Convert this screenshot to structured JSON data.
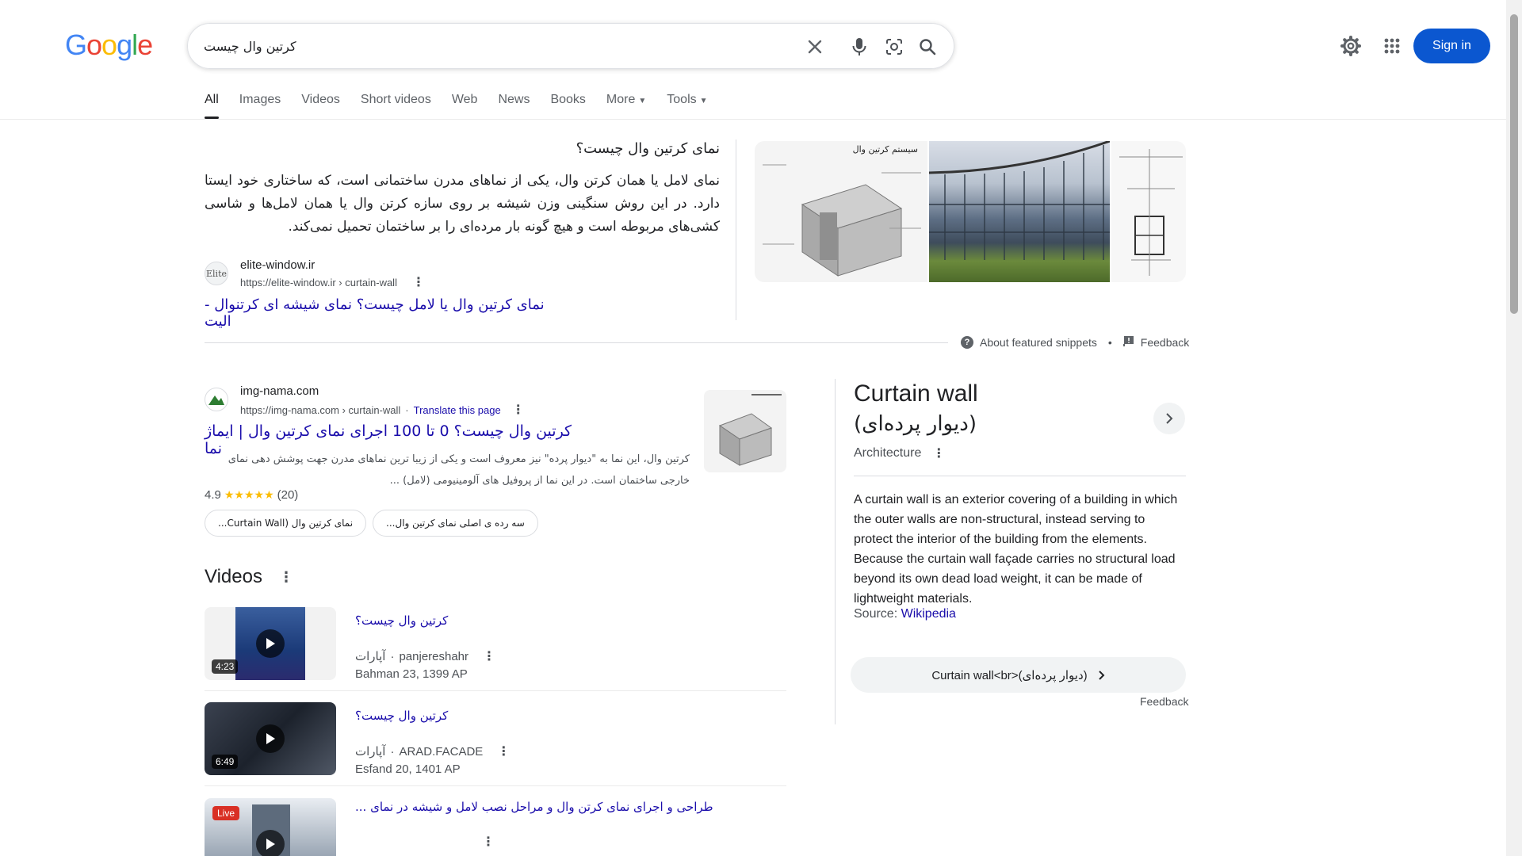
{
  "header": {
    "logo": [
      "G",
      "o",
      "o",
      "g",
      "l",
      "e"
    ],
    "search_value": "کرتین وال چیست",
    "sign_in": "Sign in"
  },
  "tabs": [
    {
      "label": "All",
      "active": true
    },
    {
      "label": "Images"
    },
    {
      "label": "Videos"
    },
    {
      "label": "Short videos"
    },
    {
      "label": "Web"
    },
    {
      "label": "News"
    },
    {
      "label": "Books"
    },
    {
      "label": "More"
    },
    {
      "label": "Tools"
    }
  ],
  "featured_snippet": {
    "question": "نمای کرتین وال چیست؟",
    "text": "نمای لامل یا همان کرتن وال، یکی از نماهای مدرن ساختمانی است، که ساختاری خود ایستا دارد. در این روش سنگینی وزن شیشه بر روی سازه کرتن وال یا همان لامل‌ها و شاسی کشی‌های مربوطه است و هیچ گونه بار مرده‌ای را بر ساختمان تحمیل نمی‌کند.",
    "site_name": "elite-window.ir",
    "site_url": "https://elite-window.ir › curtain-wall",
    "favicon_text": "Elite",
    "link_title": "نمای کرتین وال یا لامل چیست؟ نمای شیشه ای کرتنوال - الیت",
    "image1_label": "سیستم کرتین وال",
    "about": "About featured snippets",
    "feedback": "Feedback"
  },
  "result2": {
    "site_name": "img-nama.com",
    "site_url": "https://img-nama.com › curtain-wall",
    "translate": "Translate this page",
    "title": "کرتین وال چیست؟ 0 تا 100 اجرای نمای کرتین وال | ایماژ نما",
    "snippet": "کرتین وال، این نما به \"دیوار پرده\" نیز معروف است و یکی از زیبا ترین نماهای مدرن جهت پوشش دهی نمای خارجی ساختمان است. در این نما از پروفیل های آلومینیومی (لامل) ...",
    "rating": "4.9",
    "stars": "★★★★★",
    "count": "(20)",
    "chips": [
      "نمای کرتین وال (Curtain Wall...",
      "سه رده ی اصلی نمای کرتین وال..."
    ]
  },
  "videos": {
    "title": "Videos",
    "items": [
      {
        "title": "کرتین وال چیست؟",
        "source": "آپارات",
        "channel": "panjereshahr",
        "date": "Bahman 23, 1399 AP",
        "duration": "4:23"
      },
      {
        "title": "کرتین وال چیست؟",
        "source": "آپارات",
        "channel": "ARAD.FACADE",
        "date": "Esfand 20, 1401 AP",
        "duration": "6:49"
      },
      {
        "title": "طراحی و اجرای نمای کرتن وال و مراحل نصب لامل و شیشه در نمای ...",
        "source": "",
        "channel": "",
        "date": "",
        "duration": "",
        "badge": "Live"
      }
    ]
  },
  "knowledge_panel": {
    "title": "Curtain wall",
    "subtitle": "(دیوار پرده‌ای)",
    "category": "Architecture",
    "description": "A curtain wall is an exterior covering of a building in which the outer walls are non-structural, instead serving to protect the interior of the building from the elements. Because the curtain wall façade carries no structural load beyond its own dead load weight, it can be made of lightweight materials.",
    "source_label": "Source: ",
    "source_link": "Wikipedia",
    "chip": "Curtain wall<br>(دیوار پرده‌ای)",
    "feedback": "Feedback"
  },
  "colors": {
    "link": "#1a0dab",
    "signin": "#0b57d0",
    "star": "#fbbc04",
    "live": "#d93025"
  }
}
